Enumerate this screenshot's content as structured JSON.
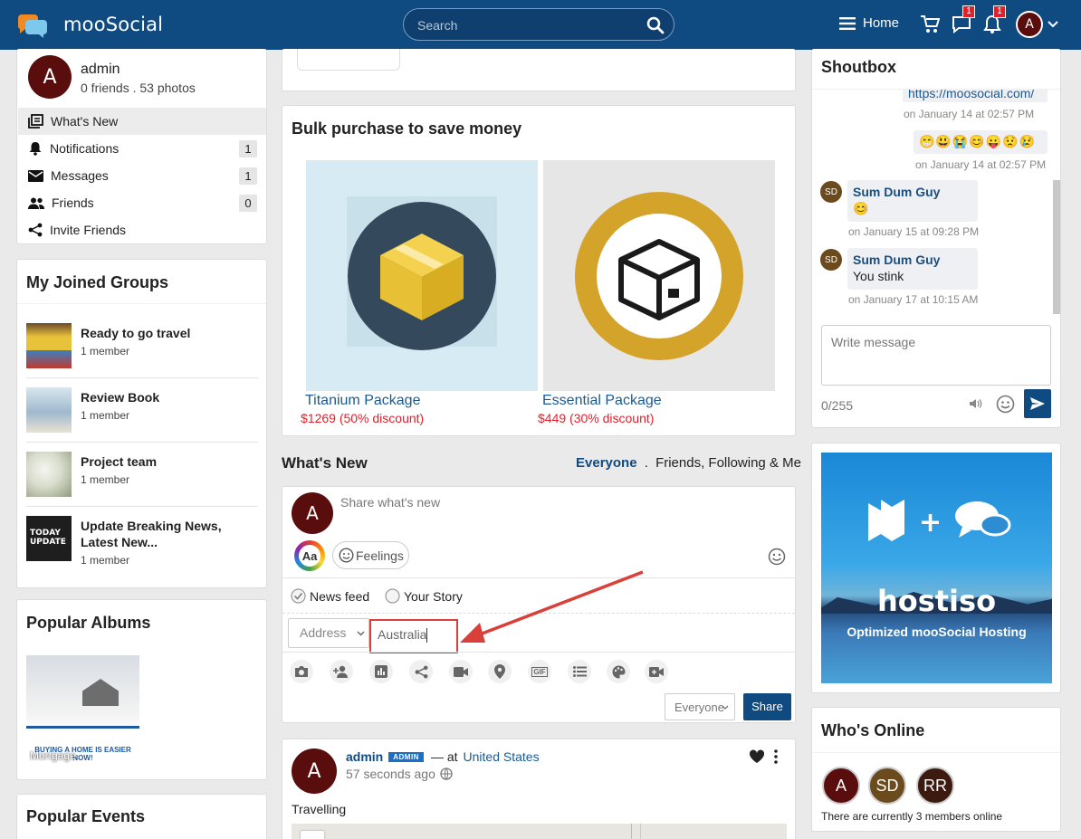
{
  "header": {
    "brand": "mooSocial",
    "search_placeholder": "Search",
    "home_label": "Home",
    "messages_badge": "1",
    "notifications_badge": "1",
    "user_initial": "A"
  },
  "profile": {
    "initial": "A",
    "name": "admin",
    "stats": "0 friends . 53 photos",
    "menu": [
      {
        "label": "What's New",
        "count": ""
      },
      {
        "label": "Notifications",
        "count": "1"
      },
      {
        "label": "Messages",
        "count": "1"
      },
      {
        "label": "Friends",
        "count": "0"
      },
      {
        "label": "Invite Friends",
        "count": ""
      }
    ]
  },
  "groups": {
    "title": "My Joined Groups",
    "items": [
      {
        "name": "Ready to go travel",
        "members": "1 member"
      },
      {
        "name": "Review Book",
        "members": "1 member"
      },
      {
        "name": "Project team",
        "members": "1 member"
      },
      {
        "name": "Update Breaking News, Latest New...",
        "members": "1 member"
      }
    ]
  },
  "albums": {
    "title": "Popular Albums",
    "album_caption": "Mortgage",
    "banner_text": "BUYING A HOME IS EASIER NOW!"
  },
  "events": {
    "title": "Popular Events"
  },
  "bulk": {
    "title": "Bulk purchase to save money",
    "packages": [
      {
        "name": "Titanium Package",
        "price": "$1269 (50% discount)"
      },
      {
        "name": "Essential Package",
        "price": "$449 (30% discount)"
      }
    ]
  },
  "whatsnew": {
    "title": "What's New",
    "filter_active": "Everyone",
    "filter_sep": ".",
    "filter_other": "Friends, Following & Me"
  },
  "composer": {
    "initial": "A",
    "placeholder": "Share what's new",
    "aa_label": "Aa",
    "feelings_label": "Feelings",
    "news_feed_label": "News feed",
    "your_story_label": "Your Story",
    "address_select": "Address",
    "address_value": "Australia",
    "privacy_select": "Everyone",
    "share_button": "Share",
    "gif_label": "GIF"
  },
  "post": {
    "initial": "A",
    "author": "admin",
    "role_badge": "ADMIN",
    "at_text": "— at",
    "location": "United States",
    "time": "57 seconds ago",
    "text": "Travelling"
  },
  "shoutbox": {
    "title": "Shoutbox",
    "messages": [
      {
        "name": "",
        "text": "https://moosocial.com/",
        "time": "on January 14 at 02:57 PM"
      },
      {
        "name": "",
        "text": "😁😃😭😊😛😟😢",
        "time": "on January 14 at 02:57 PM"
      },
      {
        "name": "Sum Dum Guy",
        "initials": "SD",
        "text": "😊",
        "time": "on January 15 at 09:28 PM"
      },
      {
        "name": "Sum Dum Guy",
        "initials": "SD",
        "text": "You stink",
        "time": "on January 17 at 10:15 AM"
      }
    ],
    "input_placeholder": "Write message",
    "counter": "0/255"
  },
  "ad": {
    "brand": "hostiso",
    "tagline": "Optimized mooSocial Hosting"
  },
  "online": {
    "title": "Who's Online",
    "members": [
      "A",
      "SD",
      "RR"
    ],
    "summary": "There are currently 3 members online"
  },
  "colors": {
    "header": "#0f4a80",
    "link": "#1b5a92",
    "price": "#e2202b",
    "accent_box": "#d9403a",
    "avatar": "#5a0d0d"
  }
}
